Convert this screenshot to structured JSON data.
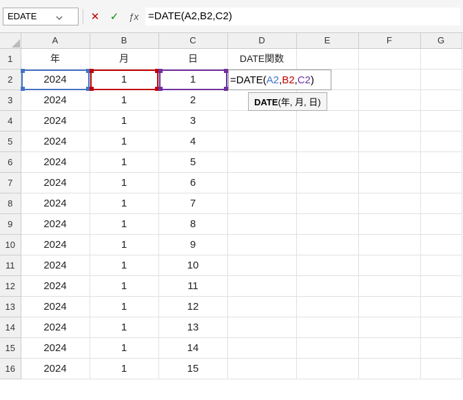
{
  "name_box": "EDATE",
  "formula_bar": "=DATE(A2,B2,C2)",
  "columns": [
    "A",
    "B",
    "C",
    "D",
    "E",
    "F",
    "G"
  ],
  "headers": {
    "A": "年",
    "B": "月",
    "C": "日",
    "D": "DATE関数"
  },
  "rows": [
    "1",
    "2",
    "3",
    "4",
    "5",
    "6",
    "7",
    "8",
    "9",
    "10",
    "11",
    "12",
    "13",
    "14",
    "15",
    "16"
  ],
  "data": {
    "A": [
      "2024",
      "2024",
      "2024",
      "2024",
      "2024",
      "2024",
      "2024",
      "2024",
      "2024",
      "2024",
      "2024",
      "2024",
      "2024",
      "2024",
      "2024"
    ],
    "B": [
      "1",
      "1",
      "1",
      "1",
      "1",
      "1",
      "1",
      "1",
      "1",
      "1",
      "1",
      "1",
      "1",
      "1",
      "1"
    ],
    "C": [
      "1",
      "2",
      "3",
      "4",
      "5",
      "6",
      "7",
      "8",
      "9",
      "10",
      "11",
      "12",
      "13",
      "14",
      "15"
    ]
  },
  "editing_cell": {
    "prefix": "=DATE(",
    "ref1": "A2",
    "sep1": ",",
    "ref2": "B2",
    "sep2": ",",
    "ref3": "C2",
    "suffix": ")"
  },
  "tooltip": {
    "fn": "DATE",
    "args": "(年, 月, 日)"
  }
}
